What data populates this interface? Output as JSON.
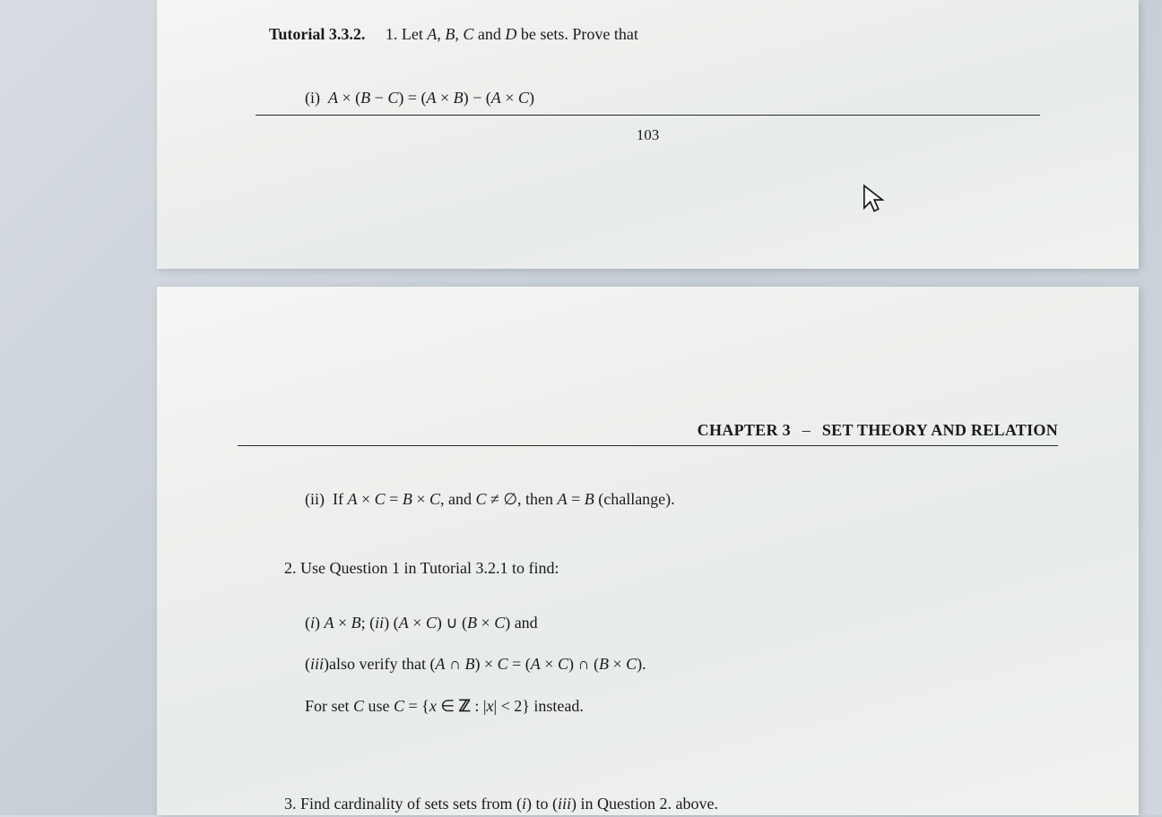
{
  "page_top": {
    "tutorial_label": "Tutorial 3.3.2.",
    "question_1_intro": "1. Let A, B, C and D be sets. Prove that",
    "item_i": "(i)  A × (B − C) = (A × B) − (A × C)",
    "page_number": "103"
  },
  "page_bottom": {
    "chapter_label": "CHAPTER 3",
    "chapter_title": "SET THEORY AND RELATION",
    "item_ii": "(ii)  If A × C = B × C, and C ≠ ∅, then A = B (challange).",
    "question_2": "2. Use Question 1 in Tutorial 3.2.1 to find:",
    "q2_item_i_ii": "(i) A × B; (ii) (A × C) ∪ (B × C) and",
    "q2_item_iii": "(iii) also verify that (A ∩ B) × C = (A × C) ∩ (B × C).",
    "for_set": "For set C use C = {x ∈ ℤ : |x| < 2} instead.",
    "question_3": "3. Find cardinality of sets sets from (i) to (iii) in Question 2. above."
  }
}
